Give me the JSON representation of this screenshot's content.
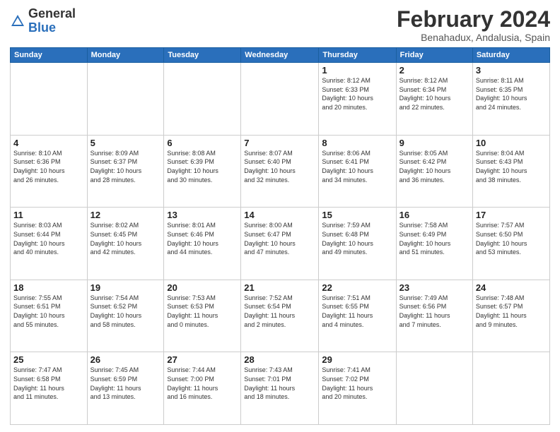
{
  "header": {
    "logo": {
      "general": "General",
      "blue": "Blue"
    },
    "title": "February 2024",
    "subtitle": "Benahadux, Andalusia, Spain"
  },
  "days_of_week": [
    "Sunday",
    "Monday",
    "Tuesday",
    "Wednesday",
    "Thursday",
    "Friday",
    "Saturday"
  ],
  "weeks": [
    [
      {
        "day": "",
        "info": ""
      },
      {
        "day": "",
        "info": ""
      },
      {
        "day": "",
        "info": ""
      },
      {
        "day": "",
        "info": ""
      },
      {
        "day": "1",
        "info": "Sunrise: 8:12 AM\nSunset: 6:33 PM\nDaylight: 10 hours\nand 20 minutes."
      },
      {
        "day": "2",
        "info": "Sunrise: 8:12 AM\nSunset: 6:34 PM\nDaylight: 10 hours\nand 22 minutes."
      },
      {
        "day": "3",
        "info": "Sunrise: 8:11 AM\nSunset: 6:35 PM\nDaylight: 10 hours\nand 24 minutes."
      }
    ],
    [
      {
        "day": "4",
        "info": "Sunrise: 8:10 AM\nSunset: 6:36 PM\nDaylight: 10 hours\nand 26 minutes."
      },
      {
        "day": "5",
        "info": "Sunrise: 8:09 AM\nSunset: 6:37 PM\nDaylight: 10 hours\nand 28 minutes."
      },
      {
        "day": "6",
        "info": "Sunrise: 8:08 AM\nSunset: 6:39 PM\nDaylight: 10 hours\nand 30 minutes."
      },
      {
        "day": "7",
        "info": "Sunrise: 8:07 AM\nSunset: 6:40 PM\nDaylight: 10 hours\nand 32 minutes."
      },
      {
        "day": "8",
        "info": "Sunrise: 8:06 AM\nSunset: 6:41 PM\nDaylight: 10 hours\nand 34 minutes."
      },
      {
        "day": "9",
        "info": "Sunrise: 8:05 AM\nSunset: 6:42 PM\nDaylight: 10 hours\nand 36 minutes."
      },
      {
        "day": "10",
        "info": "Sunrise: 8:04 AM\nSunset: 6:43 PM\nDaylight: 10 hours\nand 38 minutes."
      }
    ],
    [
      {
        "day": "11",
        "info": "Sunrise: 8:03 AM\nSunset: 6:44 PM\nDaylight: 10 hours\nand 40 minutes."
      },
      {
        "day": "12",
        "info": "Sunrise: 8:02 AM\nSunset: 6:45 PM\nDaylight: 10 hours\nand 42 minutes."
      },
      {
        "day": "13",
        "info": "Sunrise: 8:01 AM\nSunset: 6:46 PM\nDaylight: 10 hours\nand 44 minutes."
      },
      {
        "day": "14",
        "info": "Sunrise: 8:00 AM\nSunset: 6:47 PM\nDaylight: 10 hours\nand 47 minutes."
      },
      {
        "day": "15",
        "info": "Sunrise: 7:59 AM\nSunset: 6:48 PM\nDaylight: 10 hours\nand 49 minutes."
      },
      {
        "day": "16",
        "info": "Sunrise: 7:58 AM\nSunset: 6:49 PM\nDaylight: 10 hours\nand 51 minutes."
      },
      {
        "day": "17",
        "info": "Sunrise: 7:57 AM\nSunset: 6:50 PM\nDaylight: 10 hours\nand 53 minutes."
      }
    ],
    [
      {
        "day": "18",
        "info": "Sunrise: 7:55 AM\nSunset: 6:51 PM\nDaylight: 10 hours\nand 55 minutes."
      },
      {
        "day": "19",
        "info": "Sunrise: 7:54 AM\nSunset: 6:52 PM\nDaylight: 10 hours\nand 58 minutes."
      },
      {
        "day": "20",
        "info": "Sunrise: 7:53 AM\nSunset: 6:53 PM\nDaylight: 11 hours\nand 0 minutes."
      },
      {
        "day": "21",
        "info": "Sunrise: 7:52 AM\nSunset: 6:54 PM\nDaylight: 11 hours\nand 2 minutes."
      },
      {
        "day": "22",
        "info": "Sunrise: 7:51 AM\nSunset: 6:55 PM\nDaylight: 11 hours\nand 4 minutes."
      },
      {
        "day": "23",
        "info": "Sunrise: 7:49 AM\nSunset: 6:56 PM\nDaylight: 11 hours\nand 7 minutes."
      },
      {
        "day": "24",
        "info": "Sunrise: 7:48 AM\nSunset: 6:57 PM\nDaylight: 11 hours\nand 9 minutes."
      }
    ],
    [
      {
        "day": "25",
        "info": "Sunrise: 7:47 AM\nSunset: 6:58 PM\nDaylight: 11 hours\nand 11 minutes."
      },
      {
        "day": "26",
        "info": "Sunrise: 7:45 AM\nSunset: 6:59 PM\nDaylight: 11 hours\nand 13 minutes."
      },
      {
        "day": "27",
        "info": "Sunrise: 7:44 AM\nSunset: 7:00 PM\nDaylight: 11 hours\nand 16 minutes."
      },
      {
        "day": "28",
        "info": "Sunrise: 7:43 AM\nSunset: 7:01 PM\nDaylight: 11 hours\nand 18 minutes."
      },
      {
        "day": "29",
        "info": "Sunrise: 7:41 AM\nSunset: 7:02 PM\nDaylight: 11 hours\nand 20 minutes."
      },
      {
        "day": "",
        "info": ""
      },
      {
        "day": "",
        "info": ""
      }
    ]
  ]
}
